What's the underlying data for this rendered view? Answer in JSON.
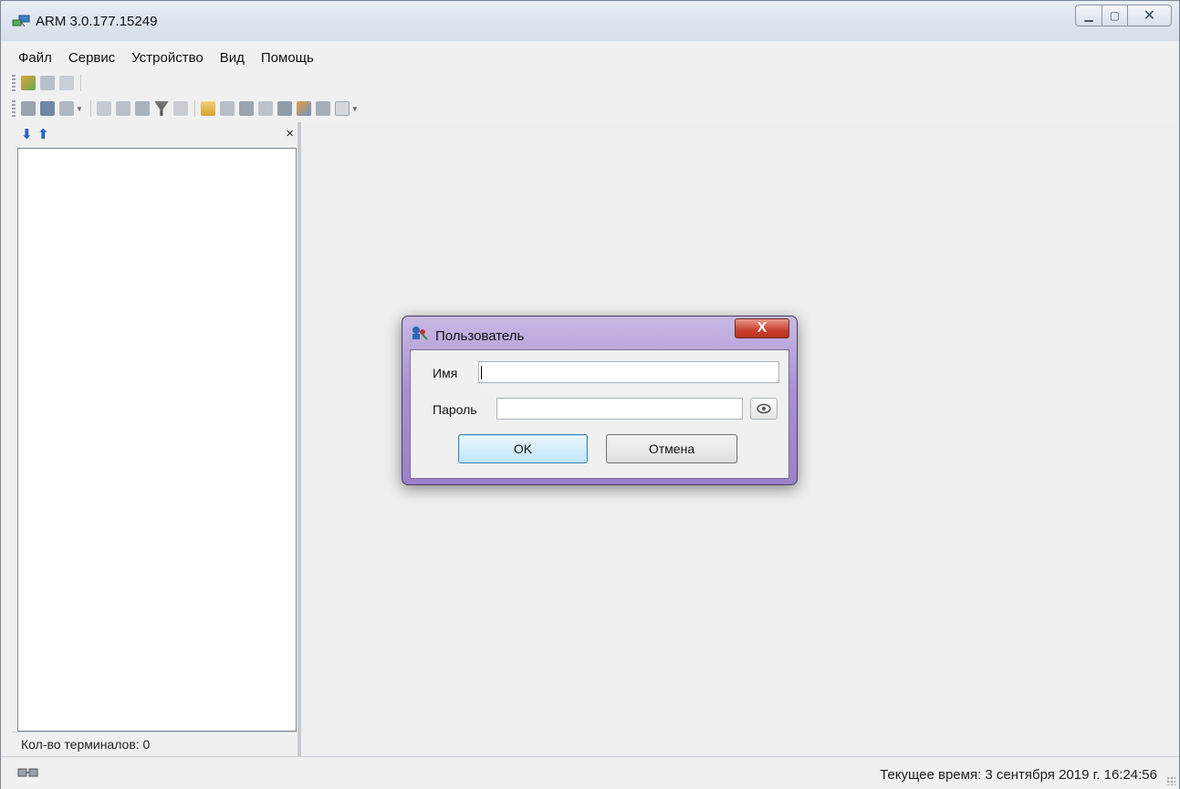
{
  "window": {
    "title": "ARM 3.0.177.15249"
  },
  "menu": {
    "items": [
      "Файл",
      "Сервис",
      "Устройство",
      "Вид",
      "Помощь"
    ]
  },
  "left_panel": {
    "close_glyph": "×",
    "footer": "Кол-во терминалов: 0"
  },
  "status": {
    "time": "Текущее время: 3 сентября 2019 г. 16:24:56"
  },
  "dialog": {
    "title": "Пользователь",
    "close_glyph": "X",
    "name_label": "Имя",
    "name_value": "",
    "password_label": "Пароль",
    "password_value": "",
    "ok_label": "OK",
    "cancel_label": "Отмена"
  },
  "icons": [
    "app-network-icon",
    "users-icon",
    "group-icon",
    "grid-icon",
    "minimize-icon",
    "maximize-icon",
    "close-icon",
    "arrow-down-icon",
    "arrow-up-icon",
    "filter-icon",
    "eye-icon",
    "connection-icon",
    "user-key-icon"
  ]
}
